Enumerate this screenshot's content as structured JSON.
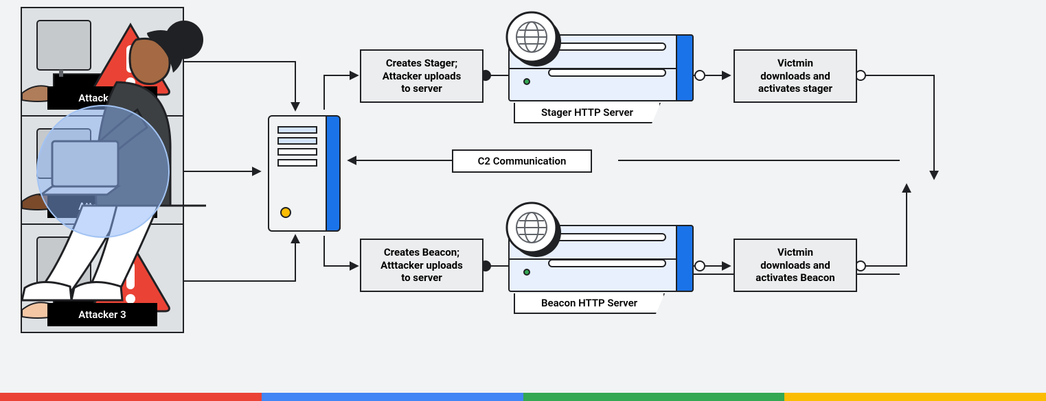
{
  "attackers": [
    "Attacker 1",
    "Attacker 2",
    "Attacker 3"
  ],
  "center": {
    "c2_label": "C2 Communication"
  },
  "top": {
    "create_stager": "Creates Stager;\nAttacker uploads\nto server",
    "server_label": "Stager HTTP Server",
    "victim_action": "Victmin\ndownloads and\nactivates stager"
  },
  "bottom": {
    "create_beacon": "Creates Beacon;\nAtttacker uploads\nto server",
    "server_label": "Beacon HTTP Server",
    "victim_action": "Victmin\ndownloads and\nactivates Beacon"
  },
  "colors": {
    "red": "#ea4335",
    "blue": "#1a73e8",
    "green": "#34a853",
    "yellow": "#fbbc04",
    "warn": "#ea4335"
  }
}
